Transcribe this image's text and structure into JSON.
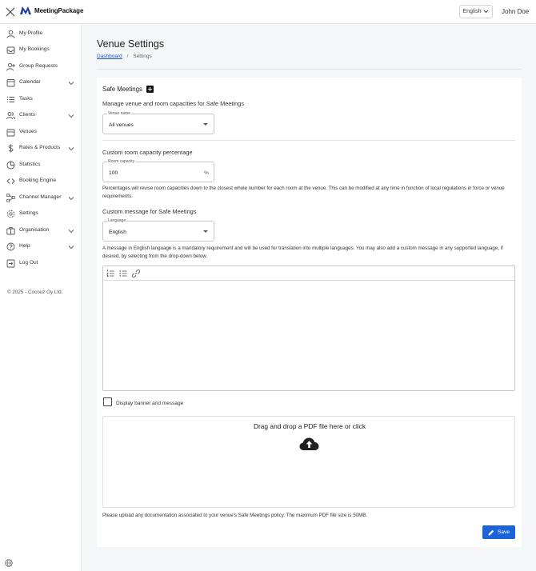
{
  "topbar": {
    "brand": "MeetingPackage",
    "language": "English",
    "user": "John Doe"
  },
  "sidebar": {
    "items": [
      {
        "label": "My Profile",
        "icon": "user-icon",
        "expandable": false
      },
      {
        "label": "My Bookings",
        "icon": "inbox-icon",
        "expandable": false
      },
      {
        "label": "Group Requests",
        "icon": "user-plus-icon",
        "expandable": false
      },
      {
        "label": "Calendar",
        "icon": "calendar-icon",
        "expandable": true
      },
      {
        "label": "Tasks",
        "icon": "list-icon",
        "expandable": false
      },
      {
        "label": "Clients",
        "icon": "users-icon",
        "expandable": true
      },
      {
        "label": "Venues",
        "icon": "building-icon",
        "expandable": false
      },
      {
        "label": "Rates & Products",
        "icon": "dollar-icon",
        "expandable": true
      },
      {
        "label": "Statistics",
        "icon": "pie-chart-icon",
        "expandable": false
      },
      {
        "label": "Booking Engine",
        "icon": "code-icon",
        "expandable": false
      },
      {
        "label": "Channel Manager",
        "icon": "network-icon",
        "expandable": true
      },
      {
        "label": "Settings",
        "icon": "gear-icon",
        "expandable": false
      },
      {
        "label": "Organisation",
        "icon": "briefcase-icon",
        "expandable": true
      },
      {
        "label": "Help",
        "icon": "help-icon",
        "expandable": true
      },
      {
        "label": "Log Out",
        "icon": "logout-icon",
        "expandable": false
      }
    ],
    "copyright": "© 2025 - Cocouz Oy Ltd."
  },
  "page": {
    "title": "Venue Settings",
    "breadcrumb_link": "Dashboard",
    "breadcrumb_sep": "/",
    "breadcrumb_current": "Settings"
  },
  "safe_meetings": {
    "title": "Safe Meetings",
    "manage_heading": "Manage venue and room capacities for Safe Meetings",
    "venue_label": "Venue name",
    "venue_value": "All venues",
    "capacity_heading": "Custom room capacity percentage",
    "capacity_label": "Room capacity",
    "capacity_value": "100",
    "capacity_suffix": "%",
    "capacity_note": "Percentages will revise room capacities down to the closest whole number for each room at the venue. This can be modified at any time in function of local regulations in force or venue requirements.",
    "message_heading": "Custom message for Safe Meetings",
    "language_label": "Language",
    "language_value": "English",
    "message_note": "A message in English language is a mandatory requirement and will be used for translation into multiple languages. You may also add a custom message in any supported language, if desired, by selecting from the drop-down below.",
    "display_label": "Display banner and message",
    "dropzone_text": "Drag and drop a PDF file here or click",
    "upload_note": "Please upload any documentation associated to your venue's Safe Meetings policy. The maximum PDF file size is 50MB.",
    "save_label": "Save"
  },
  "colors": {
    "primary": "#1a63d9",
    "link": "#1a55c4"
  }
}
